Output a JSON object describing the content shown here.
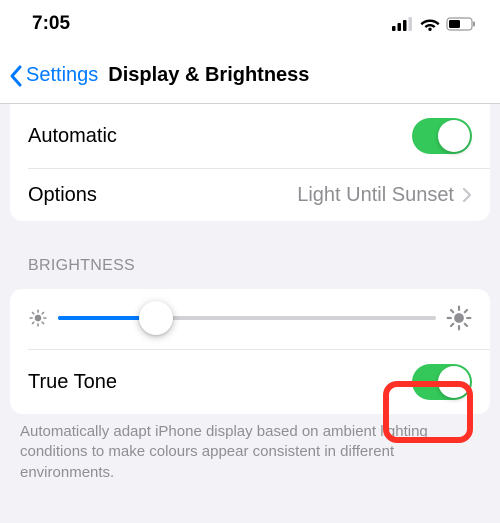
{
  "status": {
    "time": "7:05"
  },
  "nav": {
    "back_label": "Settings",
    "title": "Display & Brightness"
  },
  "rows": {
    "automatic": {
      "label": "Automatic",
      "on": true
    },
    "options": {
      "label": "Options",
      "value": "Light Until Sunset"
    },
    "truetone": {
      "label": "True Tone",
      "on": true
    }
  },
  "sections": {
    "brightness_header": "BRIGHTNESS",
    "truetone_footer": "Automatically adapt iPhone display based on ambient lighting conditions to make colours appear consistent in different environments."
  },
  "slider": {
    "value_percent": 26
  },
  "highlight": {
    "target": "truetone-toggle"
  }
}
